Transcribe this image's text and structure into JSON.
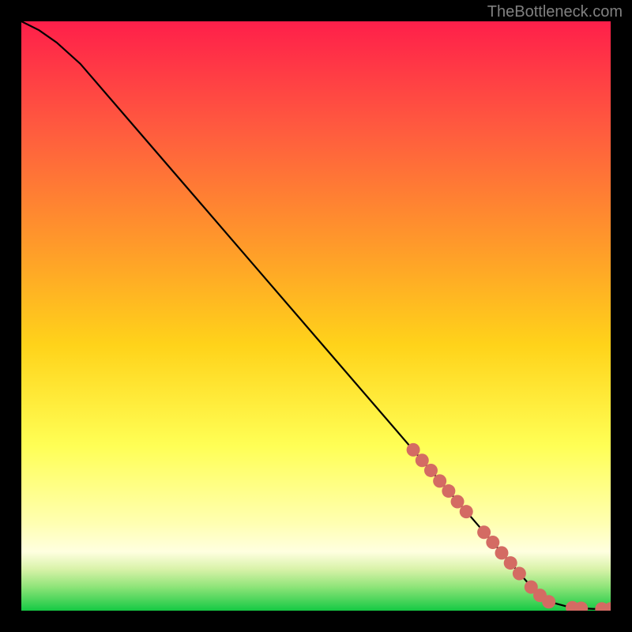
{
  "attribution": "TheBottleneck.com",
  "colors": {
    "bg": "#000000",
    "gradient_top": "#ff1f4a",
    "gradient_mid_upper": "#ff7a3a",
    "gradient_mid": "#ffd31a",
    "gradient_mid_lower": "#ffff6a",
    "gradient_pale": "#ffffcc",
    "gradient_green_light": "#9be77a",
    "gradient_green": "#1ecf4a",
    "curve": "#000000",
    "dot": "#d46b63",
    "attribution": "#808080"
  },
  "chart_data": {
    "type": "line",
    "title": "",
    "xlabel": "",
    "ylabel": "",
    "xlim": [
      0,
      100
    ],
    "ylim": [
      0,
      100
    ],
    "series": [
      {
        "name": "curve",
        "x": [
          0,
          3,
          6,
          10,
          20,
          30,
          40,
          50,
          60,
          70,
          80,
          87,
          90,
          93,
          95,
          97,
          100
        ],
        "y": [
          100,
          98.5,
          96.4,
          92.8,
          81.2,
          69.6,
          58.0,
          46.4,
          34.8,
          23.2,
          11.6,
          3.5,
          1.4,
          0.6,
          0.4,
          0.3,
          0.3
        ]
      }
    ],
    "scatter": {
      "name": "dots",
      "x": [
        66.5,
        68.0,
        69.5,
        71.0,
        72.5,
        74.0,
        75.5,
        78.5,
        80.0,
        81.5,
        83.0,
        84.5,
        86.5,
        88.0,
        89.5,
        93.5,
        95.0,
        98.5,
        100.0
      ],
      "y": [
        27.3,
        25.5,
        23.8,
        22.0,
        20.3,
        18.5,
        16.8,
        13.3,
        11.6,
        9.8,
        8.1,
        6.3,
        4.0,
        2.6,
        1.5,
        0.5,
        0.4,
        0.3,
        0.3
      ]
    }
  }
}
